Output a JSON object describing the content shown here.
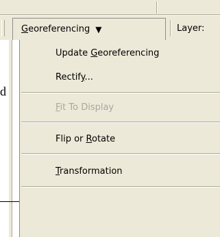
{
  "toolbar": {
    "georeferencing_menu": {
      "label_pre": "",
      "label_mnemonic": "G",
      "label_post": "eoreferencing",
      "arrow": "▼"
    },
    "layer_label": "Layer:"
  },
  "menu": {
    "items": [
      {
        "pre": "Update ",
        "mnemonic": "G",
        "post": "eoreferencing",
        "enabled": true
      },
      {
        "pre": "Rectif",
        "mnemonic": "y",
        "post": "...",
        "enabled": true
      },
      {
        "pre": "",
        "mnemonic": "F",
        "post": "it To Display",
        "enabled": false
      },
      {
        "pre": "Flip or ",
        "mnemonic": "R",
        "post": "otate",
        "enabled": true
      },
      {
        "pre": "",
        "mnemonic": "T",
        "post": "ransformation",
        "enabled": true
      }
    ]
  },
  "background": {
    "letter": "d"
  }
}
